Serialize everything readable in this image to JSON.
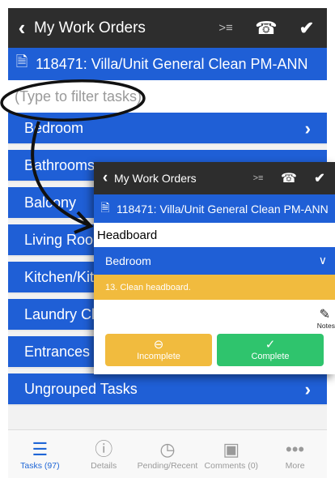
{
  "main": {
    "header": {
      "title": "My Work Orders",
      "back_icon": "chevron-left-icon",
      "icons": [
        "list-indent-icon",
        "phone-icon",
        "checkmark-icon"
      ]
    },
    "work_order": {
      "label": "118471: Villa/Unit General Clean PM-ANN",
      "icon": "document-icon"
    },
    "filter": {
      "placeholder": "(Type to filter tasks)",
      "value": ""
    },
    "groups": [
      "Bedroom",
      "Bathrooms",
      "Balcony",
      "Living Room",
      "Kitchen/Kitchenette",
      "Laundry Closet",
      "Entrances",
      "Ungrouped Tasks"
    ],
    "tabs": [
      {
        "label": "Tasks (97)",
        "icon": "list-icon",
        "active": true
      },
      {
        "label": "Details",
        "icon": "info-icon",
        "active": false
      },
      {
        "label": "Pending/Recent",
        "icon": "clock-icon",
        "active": false
      },
      {
        "label": "Comments (0)",
        "icon": "photo-comment-icon",
        "active": false
      },
      {
        "label": "More",
        "icon": "more-icon",
        "active": false
      }
    ]
  },
  "overlay": {
    "header": {
      "title": "My Work Orders"
    },
    "work_order": {
      "label": "118471: Villa/Unit General Clean PM-ANN"
    },
    "filter": {
      "value": "Headboard"
    },
    "group": {
      "label": "Bedroom"
    },
    "task": {
      "label": "13. Clean headboard."
    },
    "notes_label": "Notes",
    "buttons": {
      "incomplete": "Incomplete",
      "complete": "Complete"
    }
  },
  "colors": {
    "header_dark": "#2d2d2d",
    "brand_blue": "#1f5fd6",
    "task_yellow": "#f1bb3e",
    "complete_green": "#2fc46d",
    "active_tab": "#1f66d6"
  }
}
